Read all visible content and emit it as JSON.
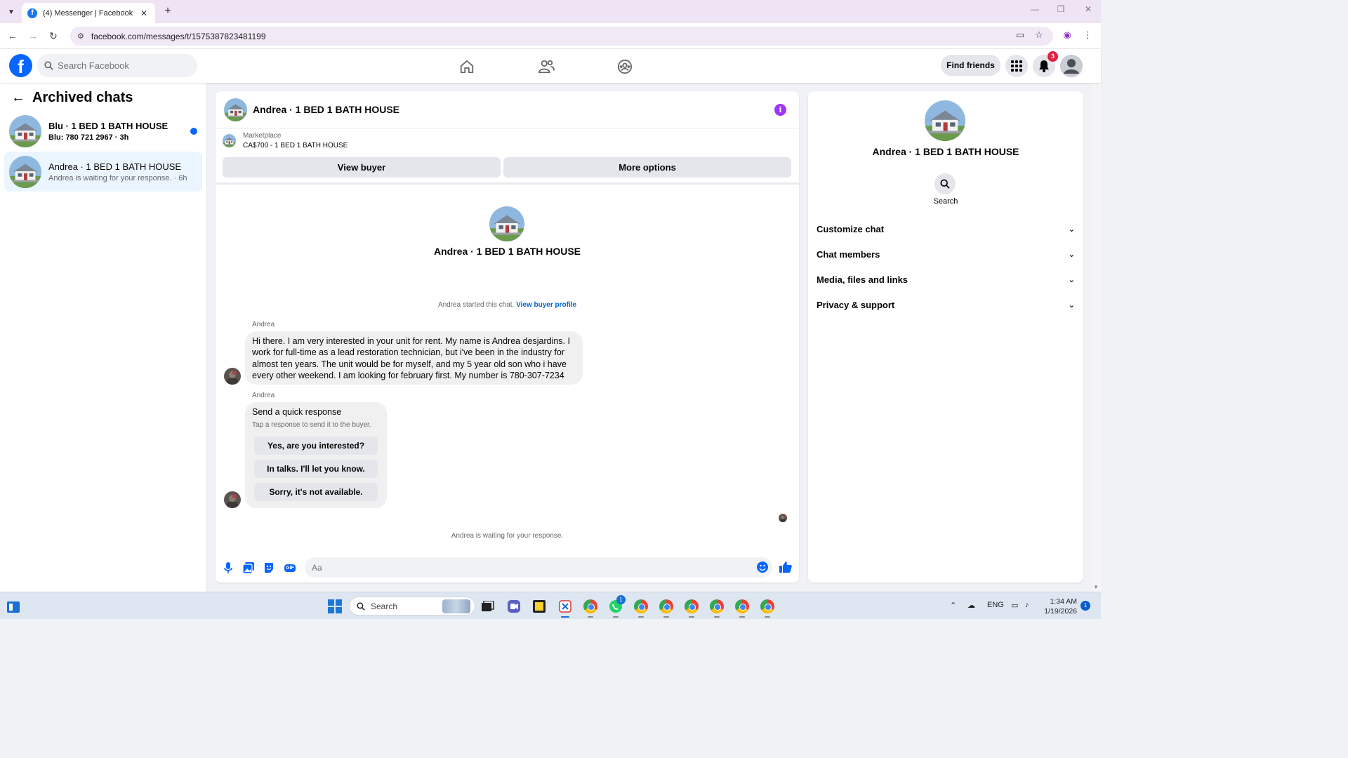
{
  "browser": {
    "tab_title": "(4) Messenger | Facebook",
    "tab_favicon": "f",
    "url": "facebook.com/messages/t/1575387823481199"
  },
  "fb": {
    "logo": "f",
    "search_placeholder": "Search Facebook",
    "find_friends": "Find friends",
    "notification_count": "3"
  },
  "archived": {
    "title": "Archived chats",
    "chats": [
      {
        "name": "Blu · 1 BED 1 BATH HOUSE",
        "preview": "Blu: 780 721 2967 · 3h",
        "unread": true
      },
      {
        "name": "Andrea · 1 BED 1 BATH HOUSE",
        "preview": "Andrea is waiting for your response. · 6h",
        "unread": false
      }
    ]
  },
  "conversation": {
    "title": "Andrea · 1 BED 1 BATH HOUSE",
    "marketplace_label": "Marketplace",
    "listing": "CA$700 - 1 BED 1 BATH HOUSE",
    "view_buyer": "View buyer",
    "more_options": "More options",
    "intro_name": "Andrea · 1 BED 1 BATH HOUSE",
    "started_text": "Andrea started this chat. ",
    "view_buyer_profile": "View buyer profile",
    "sender1": "Andrea",
    "message1": "Hi there. I am very interested in your unit for rent. My name is Andrea desjardins. I work for full-time as a lead restoration technician, but i've been in the industry for almost ten years. The unit would be for myself, and my 5 year old son who i have every other weekend. I am looking for february first. My number is 780-307-7234",
    "sender2": "Andrea",
    "quick_title": "Send a quick response",
    "quick_sub": "Tap a response to send it to the buyer.",
    "quick_responses": [
      "Yes, are you interested?",
      "In talks. I'll let you know.",
      "Sorry, it's not available."
    ],
    "waiting": "Andrea is waiting for your response.",
    "composer_placeholder": "Aa",
    "gif_label": "GIF"
  },
  "details": {
    "name": "Andrea · 1 BED 1 BATH HOUSE",
    "search_label": "Search",
    "sections": [
      "Customize chat",
      "Chat members",
      "Media, files and links",
      "Privacy & support"
    ]
  },
  "taskbar": {
    "search": "Search",
    "lang": "ENG",
    "time": "1:34 AM",
    "date": "1/19/2026",
    "notif_count": "1",
    "whatsapp_badge": "1"
  }
}
